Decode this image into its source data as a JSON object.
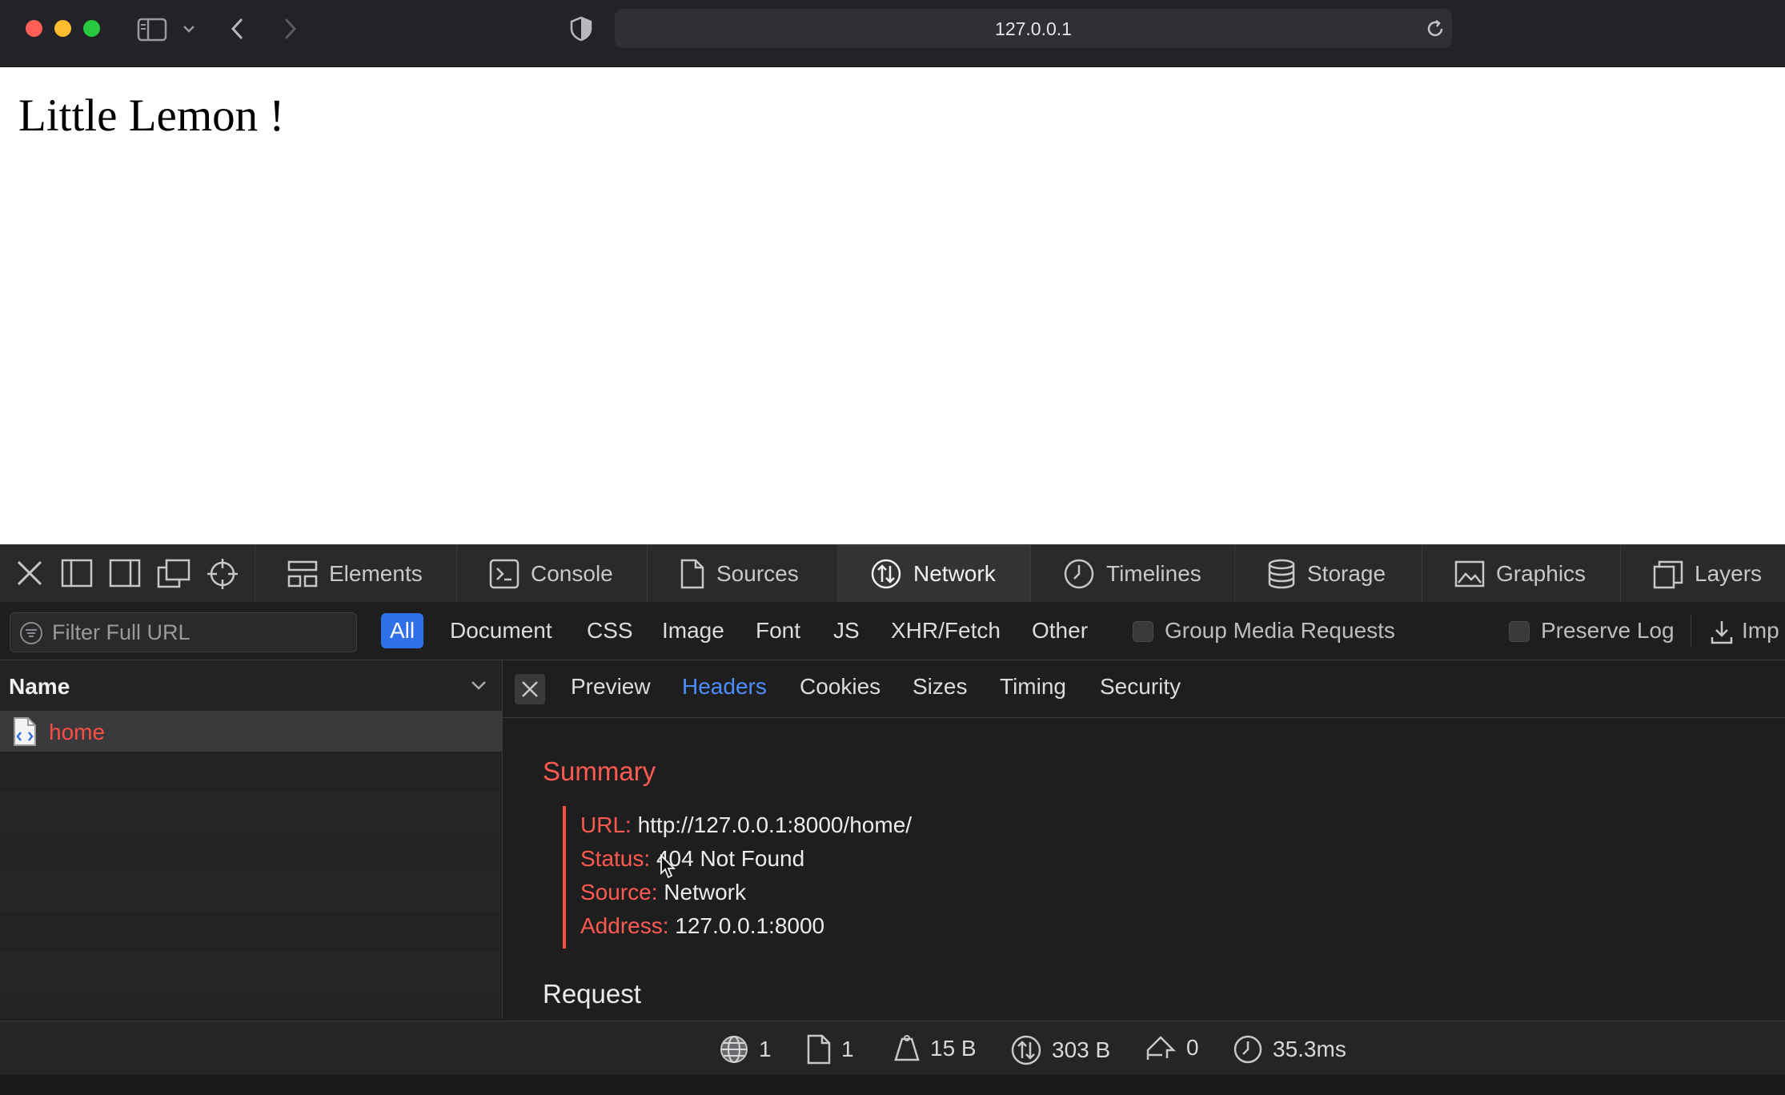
{
  "browser": {
    "url": "127.0.0.1"
  },
  "page": {
    "heading": "Little Lemon !"
  },
  "devtools": {
    "tabs": [
      "Elements",
      "Console",
      "Sources",
      "Network",
      "Timelines",
      "Storage",
      "Graphics",
      "Layers"
    ],
    "active_tab": "Network",
    "filter_placeholder": "Filter Full URL",
    "filter_types": [
      "All",
      "Document",
      "CSS",
      "Image",
      "Font",
      "JS",
      "XHR/Fetch",
      "Other"
    ],
    "active_filter": "All",
    "group_media_label": "Group Media Requests",
    "preserve_log_label": "Preserve Log",
    "import_label": "Imp",
    "name_header": "Name",
    "requests": [
      {
        "name": "home",
        "status_color": "#ff4e45"
      }
    ],
    "detail_tabs": [
      "Preview",
      "Headers",
      "Cookies",
      "Sizes",
      "Timing",
      "Security"
    ],
    "active_detail_tab": "Headers",
    "summary": {
      "title": "Summary",
      "url_key": "URL:",
      "url_val": "http://127.0.0.1:8000/home/",
      "status_key": "Status:",
      "status_val": "404 Not Found",
      "source_key": "Source:",
      "source_val": "Network",
      "address_key": "Address:",
      "address_val": "127.0.0.1:8000"
    },
    "request_title": "Request",
    "status_bar": {
      "domains": "1",
      "resources": "1",
      "transferred": "15 B",
      "size": "303 B",
      "redirects": "0",
      "time": "35.3ms"
    }
  }
}
